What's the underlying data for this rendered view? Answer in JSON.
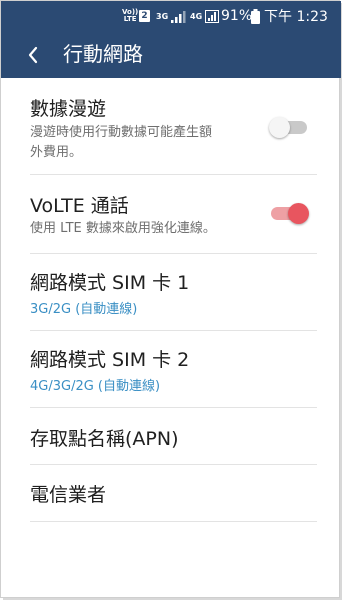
{
  "status_bar": {
    "volte_top": "VoLTE",
    "volte_line1": "Vo))",
    "volte_line2": "LTE",
    "sim2_badge": "2",
    "net1": "3G",
    "net2": "4G",
    "battery": "91%",
    "time": "下午 1:23"
  },
  "app_bar": {
    "title": "行動網路",
    "back_icon": "arrow-back-icon"
  },
  "settings": {
    "data_roaming": {
      "title": "數據漫遊",
      "description_line1": "漫遊時使用行動數據可能產生額",
      "description_line2": "外費用。",
      "enabled": false
    },
    "volte_calls": {
      "title": "VoLTE 通話",
      "description": "使用 LTE 數據來啟用強化連線。",
      "enabled": true
    },
    "network_mode_sim1": {
      "title": "網路模式 SIM 卡 1",
      "value": "3G/2G (自動連線)"
    },
    "network_mode_sim2": {
      "title": "網路模式 SIM 卡 2",
      "value": "4G/3G/2G (自動連線)"
    },
    "apn": {
      "title": "存取點名稱(APN)"
    },
    "carriers": {
      "title": "電信業者"
    }
  },
  "colors": {
    "app_bar": "#2b4a73",
    "accent_value": "#3a8fc4",
    "toggle_on_thumb": "#e8555f",
    "toggle_on_track": "#eea0a4",
    "toggle_off_thumb": "#f5f5f5",
    "toggle_off_track": "#c9c9c9"
  }
}
